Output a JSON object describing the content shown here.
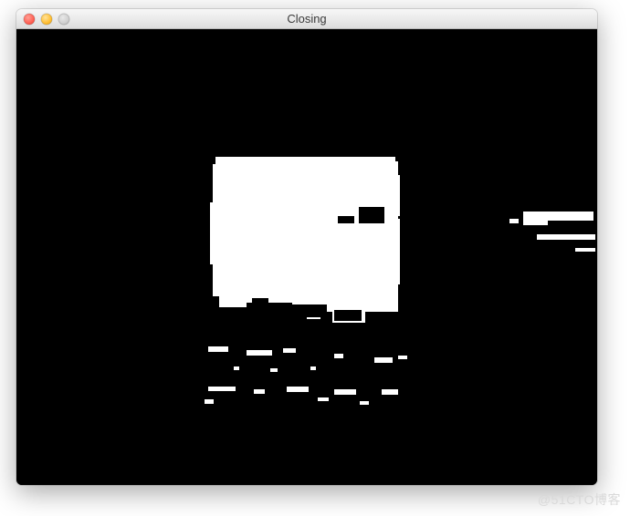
{
  "window": {
    "title": "Closing"
  },
  "traffic_lights": {
    "close": "close",
    "minimize": "minimize",
    "zoom": "zoom"
  },
  "watermark": "@51CTO博客",
  "image_output": {
    "description": "binary-morphology-closing-result",
    "foreground": "#ffffff",
    "background": "#000000"
  }
}
